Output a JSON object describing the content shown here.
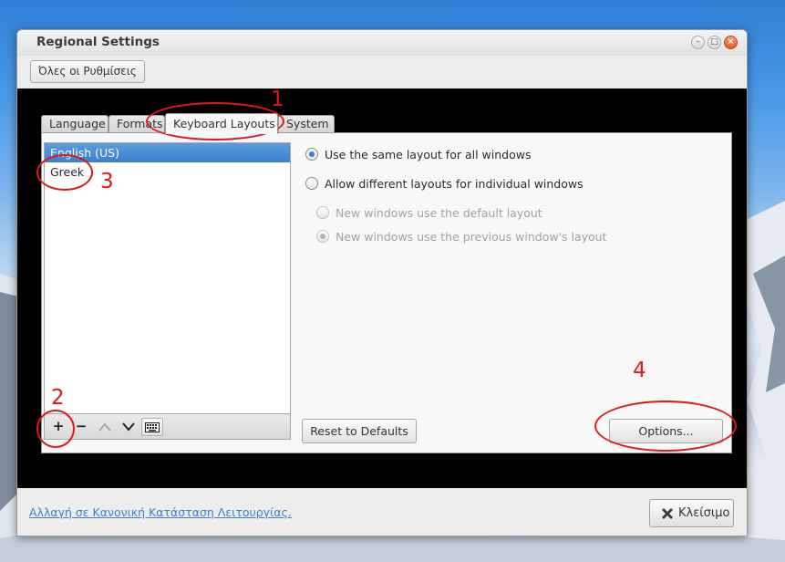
{
  "window": {
    "title": "Regional Settings",
    "all_settings_label": "Όλες οι Ρυθμίσεις"
  },
  "tabs": [
    {
      "label": "Language"
    },
    {
      "label": "Formats"
    },
    {
      "label": "Keyboard Layouts",
      "active": true
    },
    {
      "label": "System"
    }
  ],
  "layouts": [
    {
      "label": "English (US)",
      "selected": true
    },
    {
      "label": "Greek",
      "selected": false
    }
  ],
  "layout_tools": {
    "add": "+",
    "remove": "−",
    "icons": [
      "add-icon",
      "remove-icon",
      "up-arrow-icon",
      "down-arrow-icon",
      "keyboard-icon"
    ]
  },
  "options": {
    "same_layout": "Use the same layout for all windows",
    "different_layouts": "Allow different layouts for individual windows",
    "new_default": "New windows use the default layout",
    "new_previous": "New windows use the previous window's layout"
  },
  "buttons": {
    "reset": "Reset to Defaults",
    "options": "Options...",
    "close": "Κλείσιμο"
  },
  "bottom_link": "Αλλαγή  σε Κανονική Κατάσταση Λειτουργίας.",
  "annotations": [
    "1",
    "2",
    "3",
    "4"
  ],
  "colors": {
    "selection": "#3b7fcf",
    "annotation": "#e01818",
    "link": "#3b7fd4"
  }
}
